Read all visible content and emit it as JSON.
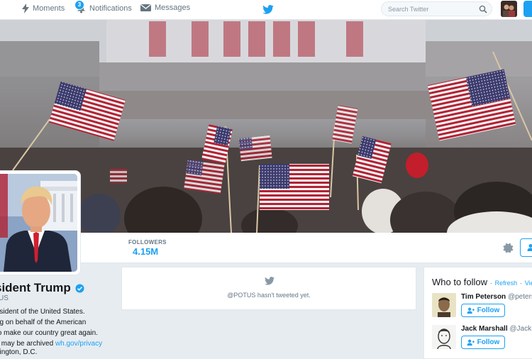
{
  "nav": {
    "moments": "Moments",
    "notifications": "Notifications",
    "notifications_count": "3",
    "messages": "Messages"
  },
  "search": {
    "placeholder": "Search Twitter"
  },
  "profile": {
    "followers_label": "FOLLOWERS",
    "followers_value": "4.15M",
    "name": "sident Trump",
    "handle": "US",
    "bio_line1": "esident of the United States.",
    "bio_line2": "ng on behalf of the American",
    "bio_line3": "to make our country great again.",
    "bio_line4_prefix": "s may be archived ",
    "bio_link": "wh.gov/privacy",
    "bio_line5": "hington, D.C."
  },
  "timeline": {
    "empty_message": "@POTUS hasn't tweeted yet."
  },
  "who_to_follow": {
    "title": "Who to follow",
    "dot": "·",
    "refresh": "Refresh",
    "view_all": "View all",
    "users": [
      {
        "name": "Tim Peterson",
        "handle": "@peterso",
        "follow": "Follow"
      },
      {
        "name": "Jack Marshall",
        "handle": "@JackMa",
        "follow": "Follow"
      }
    ]
  },
  "colors": {
    "accent": "#1da1f2",
    "text": "#14171a",
    "muted": "#657786"
  },
  "icons": [
    "bolt-icon",
    "bell-icon",
    "mail-icon",
    "bird-logo-icon",
    "search-icon",
    "gear-icon",
    "verified-icon",
    "add-user-icon"
  ]
}
